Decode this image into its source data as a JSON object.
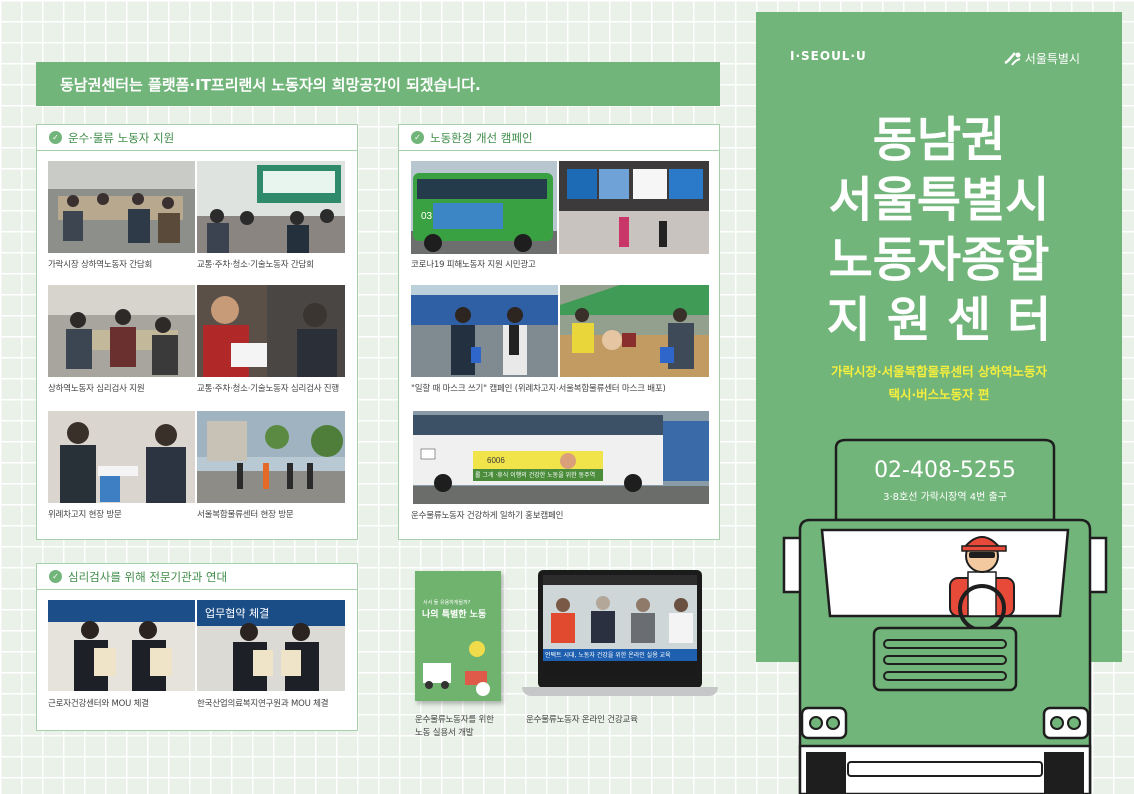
{
  "banner": {
    "text": "동남권센터는 플랫폼·IT프리랜서 노동자의 희망공간이 되겠습니다."
  },
  "section_transport": {
    "title": "운수·물류 노동자 지원",
    "captions": [
      "가락시장 상하역노동자 간담회",
      "교통·주차·청소·기술노동자 간담회",
      "상하역노동자 심리검사 지원",
      "교통·주차·청소·기술노동자 심리검사 진행",
      "위례차고지 현장 방문",
      "서울복합물류센터 현장 방문"
    ]
  },
  "section_campaign": {
    "title": "노동환경 개선 캠페인",
    "captions": [
      "코로나19 피해노동자 지원 시민광고",
      "\"일할 때 마스크 쓰기\" 캠페인 (위례차고지·서울복합물류센터 마스크 배포)",
      "운수물류노동자 건강하게 일하기 홍보캠페인"
    ],
    "bus_number": "03",
    "bus_plate": "6006",
    "bus_banner": "롤 그게 ·휴식 이행의 건강한 노동을 위한 동주역"
  },
  "section_mou": {
    "title": "심리검사를 위해 전문기관과 연대",
    "captions": [
      "근로자건강센터와 MOU 체결",
      "한국산업의료복지연구원과 MOU 체결"
    ],
    "sign_text": "업무협약 체결"
  },
  "booklet": {
    "small": "서서 둘 유용하게될까?",
    "title": "나의 특별한 노동",
    "caption_line1": "운수물류노동자를 위한",
    "caption_line2": "노동 실용서 개발"
  },
  "laptop": {
    "caption": "운수물류노동자 온라인 건강교육",
    "screen_text": "언택트 시대, 노동자 건강을 위한 온라인 실용 교육"
  },
  "cover": {
    "logo_left": "I·SEOUL·U",
    "logo_right": "서울특별시",
    "title_lines": [
      "동남권",
      "서울특별시",
      "노동자종합",
      "지원센터"
    ],
    "subtitle_line1": "가락시장·서울복합물류센터 상하역노동자",
    "subtitle_line2": "택시·버스노동자 편",
    "phone": "02-408-5255",
    "address": "3·8호선 가락시장역 4번 출구"
  },
  "colors": {
    "primary_green": "#72b57a",
    "dark_green": "#3f8c49",
    "accent_yellow": "#f4ee3e"
  },
  "icons": {
    "check": "check-circle-icon",
    "seoul_logo": "seoul-logo-icon",
    "truck": "truck-icon"
  }
}
